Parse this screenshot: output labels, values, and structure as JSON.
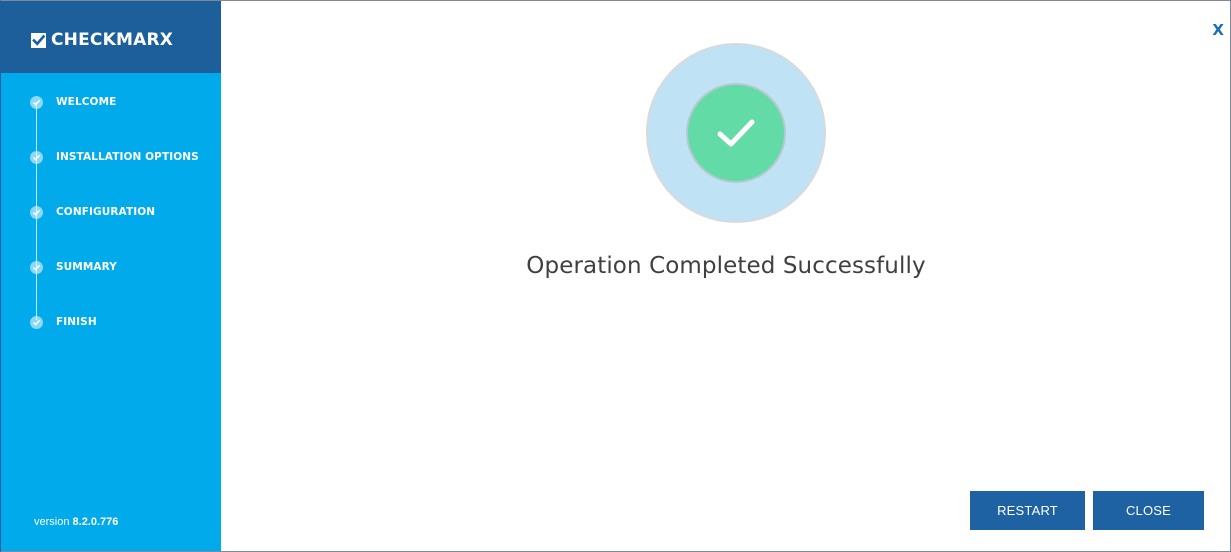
{
  "brand": {
    "name": "CHECKMARX"
  },
  "sidebar": {
    "steps": [
      {
        "label": "WELCOME"
      },
      {
        "label": "INSTALLATION OPTIONS"
      },
      {
        "label": "CONFIGURATION"
      },
      {
        "label": "SUMMARY"
      },
      {
        "label": "FINISH"
      }
    ],
    "version_label": "version",
    "version_number": "8.2.0.776"
  },
  "window": {
    "close_glyph": "X"
  },
  "status": {
    "icon": "check-icon",
    "message": "Operation Completed Successfully"
  },
  "buttons": {
    "restart_label": "RESTART",
    "close_label": "CLOSE"
  },
  "colors": {
    "sidebar": "#01aaeb",
    "sidebar_header": "#1c5f9b",
    "button": "#1f62a3",
    "success_green": "#62dba6",
    "halo": "#bfe3f5"
  }
}
